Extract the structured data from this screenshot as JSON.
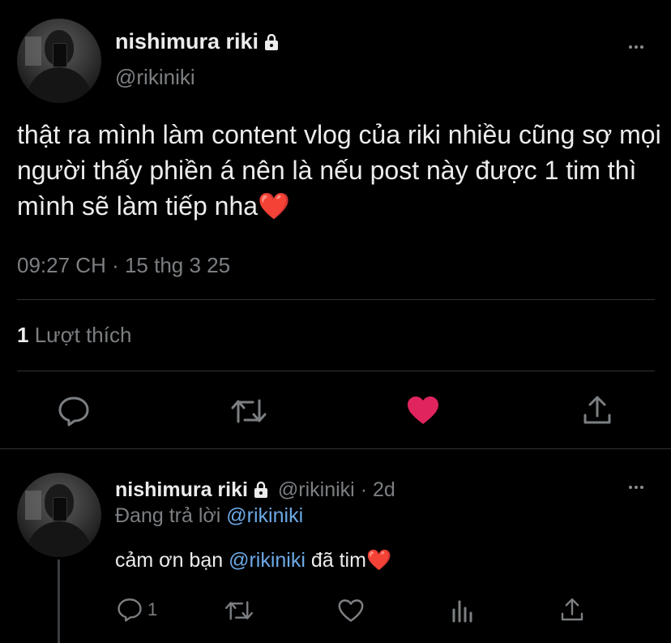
{
  "tweet": {
    "author_name": "nishimura riki",
    "author_handle": "@rikiniki",
    "text": "thật ra mình làm content vlog của riki nhiều cũng sợ mọi người thấy phiền á nên là nếu post này được 1 tim thì mình sẽ làm tiếp nha",
    "emoji": "❤️",
    "timestamp": "09:27 CH · 15 thg 3 25",
    "likes_count": "1",
    "likes_label": "Lượt thích"
  },
  "reply": {
    "author_name": "nishimura riki",
    "author_handle": "@rikiniki",
    "separator": "·",
    "age": "2d",
    "replying_prefix": "Đang trả lời",
    "replying_to": "@rikiniki",
    "text_before": "cảm ơn bạn ",
    "text_mention": "@rikiniki",
    "text_after": " đã tim",
    "emoji": "❤️",
    "reply_count": "1"
  },
  "icons": {
    "more": "more-icon",
    "lock": "lock-icon",
    "reply": "reply-icon",
    "retweet": "retweet-icon",
    "like": "like-icon",
    "share": "share-icon",
    "analytics": "analytics-icon"
  },
  "colors": {
    "background": "#000000",
    "text": "#ececec",
    "muted": "#7c7f82",
    "link": "#6ca9e6",
    "liked": "#e0245e",
    "divider": "#2f3336"
  }
}
